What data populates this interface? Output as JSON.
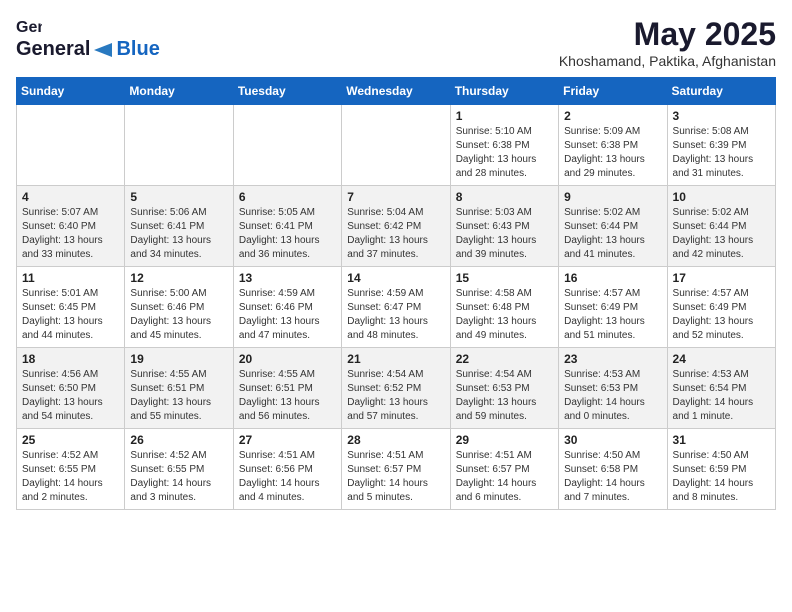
{
  "app": {
    "logo_general": "General",
    "logo_blue": "Blue",
    "month_year": "May 2025",
    "location": "Khoshamand, Paktika, Afghanistan"
  },
  "calendar": {
    "days_of_week": [
      "Sunday",
      "Monday",
      "Tuesday",
      "Wednesday",
      "Thursday",
      "Friday",
      "Saturday"
    ],
    "rows": [
      [
        {
          "day": "",
          "info": ""
        },
        {
          "day": "",
          "info": ""
        },
        {
          "day": "",
          "info": ""
        },
        {
          "day": "",
          "info": ""
        },
        {
          "day": "1",
          "info": "Sunrise: 5:10 AM\nSunset: 6:38 PM\nDaylight: 13 hours\nand 28 minutes."
        },
        {
          "day": "2",
          "info": "Sunrise: 5:09 AM\nSunset: 6:38 PM\nDaylight: 13 hours\nand 29 minutes."
        },
        {
          "day": "3",
          "info": "Sunrise: 5:08 AM\nSunset: 6:39 PM\nDaylight: 13 hours\nand 31 minutes."
        }
      ],
      [
        {
          "day": "4",
          "info": "Sunrise: 5:07 AM\nSunset: 6:40 PM\nDaylight: 13 hours\nand 33 minutes."
        },
        {
          "day": "5",
          "info": "Sunrise: 5:06 AM\nSunset: 6:41 PM\nDaylight: 13 hours\nand 34 minutes."
        },
        {
          "day": "6",
          "info": "Sunrise: 5:05 AM\nSunset: 6:41 PM\nDaylight: 13 hours\nand 36 minutes."
        },
        {
          "day": "7",
          "info": "Sunrise: 5:04 AM\nSunset: 6:42 PM\nDaylight: 13 hours\nand 37 minutes."
        },
        {
          "day": "8",
          "info": "Sunrise: 5:03 AM\nSunset: 6:43 PM\nDaylight: 13 hours\nand 39 minutes."
        },
        {
          "day": "9",
          "info": "Sunrise: 5:02 AM\nSunset: 6:44 PM\nDaylight: 13 hours\nand 41 minutes."
        },
        {
          "day": "10",
          "info": "Sunrise: 5:02 AM\nSunset: 6:44 PM\nDaylight: 13 hours\nand 42 minutes."
        }
      ],
      [
        {
          "day": "11",
          "info": "Sunrise: 5:01 AM\nSunset: 6:45 PM\nDaylight: 13 hours\nand 44 minutes."
        },
        {
          "day": "12",
          "info": "Sunrise: 5:00 AM\nSunset: 6:46 PM\nDaylight: 13 hours\nand 45 minutes."
        },
        {
          "day": "13",
          "info": "Sunrise: 4:59 AM\nSunset: 6:46 PM\nDaylight: 13 hours\nand 47 minutes."
        },
        {
          "day": "14",
          "info": "Sunrise: 4:59 AM\nSunset: 6:47 PM\nDaylight: 13 hours\nand 48 minutes."
        },
        {
          "day": "15",
          "info": "Sunrise: 4:58 AM\nSunset: 6:48 PM\nDaylight: 13 hours\nand 49 minutes."
        },
        {
          "day": "16",
          "info": "Sunrise: 4:57 AM\nSunset: 6:49 PM\nDaylight: 13 hours\nand 51 minutes."
        },
        {
          "day": "17",
          "info": "Sunrise: 4:57 AM\nSunset: 6:49 PM\nDaylight: 13 hours\nand 52 minutes."
        }
      ],
      [
        {
          "day": "18",
          "info": "Sunrise: 4:56 AM\nSunset: 6:50 PM\nDaylight: 13 hours\nand 54 minutes."
        },
        {
          "day": "19",
          "info": "Sunrise: 4:55 AM\nSunset: 6:51 PM\nDaylight: 13 hours\nand 55 minutes."
        },
        {
          "day": "20",
          "info": "Sunrise: 4:55 AM\nSunset: 6:51 PM\nDaylight: 13 hours\nand 56 minutes."
        },
        {
          "day": "21",
          "info": "Sunrise: 4:54 AM\nSunset: 6:52 PM\nDaylight: 13 hours\nand 57 minutes."
        },
        {
          "day": "22",
          "info": "Sunrise: 4:54 AM\nSunset: 6:53 PM\nDaylight: 13 hours\nand 59 minutes."
        },
        {
          "day": "23",
          "info": "Sunrise: 4:53 AM\nSunset: 6:53 PM\nDaylight: 14 hours\nand 0 minutes."
        },
        {
          "day": "24",
          "info": "Sunrise: 4:53 AM\nSunset: 6:54 PM\nDaylight: 14 hours\nand 1 minute."
        }
      ],
      [
        {
          "day": "25",
          "info": "Sunrise: 4:52 AM\nSunset: 6:55 PM\nDaylight: 14 hours\nand 2 minutes."
        },
        {
          "day": "26",
          "info": "Sunrise: 4:52 AM\nSunset: 6:55 PM\nDaylight: 14 hours\nand 3 minutes."
        },
        {
          "day": "27",
          "info": "Sunrise: 4:51 AM\nSunset: 6:56 PM\nDaylight: 14 hours\nand 4 minutes."
        },
        {
          "day": "28",
          "info": "Sunrise: 4:51 AM\nSunset: 6:57 PM\nDaylight: 14 hours\nand 5 minutes."
        },
        {
          "day": "29",
          "info": "Sunrise: 4:51 AM\nSunset: 6:57 PM\nDaylight: 14 hours\nand 6 minutes."
        },
        {
          "day": "30",
          "info": "Sunrise: 4:50 AM\nSunset: 6:58 PM\nDaylight: 14 hours\nand 7 minutes."
        },
        {
          "day": "31",
          "info": "Sunrise: 4:50 AM\nSunset: 6:59 PM\nDaylight: 14 hours\nand 8 minutes."
        }
      ]
    ]
  }
}
